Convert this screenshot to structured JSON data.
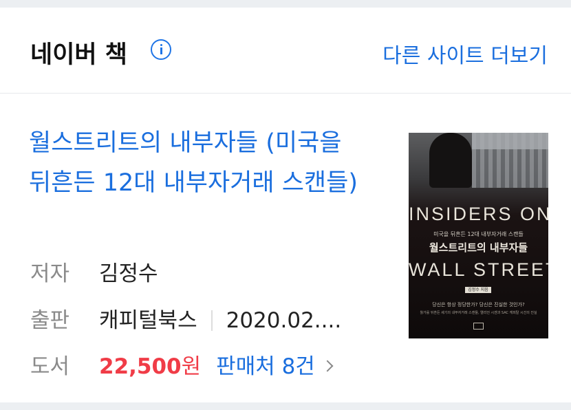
{
  "header": {
    "title": "네이버 책",
    "more_link": "다른 사이트 더보기"
  },
  "book": {
    "title": "월스트리트의 내부자들 (미국을 뒤흔든 12대 내부자거래 스캔들)",
    "author_label": "저자",
    "author": "김정수",
    "publisher_label": "출판",
    "publisher": "캐피털북스",
    "date": "2020.02....",
    "book_label": "도서",
    "price": "22,500",
    "price_unit": "원",
    "sellers": "판매처 8건",
    "cover": {
      "line1": "INSIDERS ON",
      "subtitle": "미국을 뒤흔든 12대 내부자거래 스캔들",
      "korean_title": "월스트리트의 내부자들",
      "line2": "WALL STREET",
      "author_tag": "김정수 지음",
      "tagline": "당신은 항상 정당한가? 당신은 진실한 것인가?",
      "tagline2": "월가를 뒤흔든 세기의 내부자거래 스캔들, 엘리언 시겐과 SAC 캐피탈 시건의 진실"
    }
  },
  "colors": {
    "link_blue": "#1a6ede",
    "price_red": "#f03c47",
    "label_gray": "#8a8a8a",
    "icon_blue": "#1e74e6"
  },
  "icons": {
    "info": "info-icon",
    "chevron": "chevron-right-icon"
  }
}
